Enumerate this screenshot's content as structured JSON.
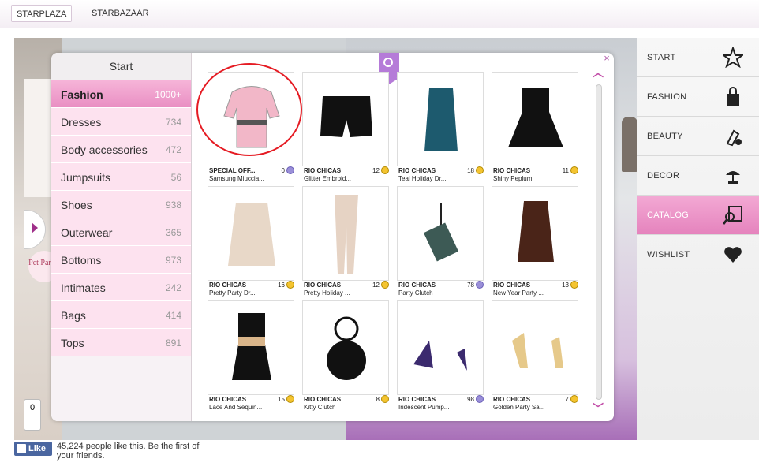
{
  "topbar": {
    "tab1": "STARPLAZA",
    "tab2": "STARBAZAAR"
  },
  "scene": {
    "pet_label": "Pet Parlor",
    "counter": "0"
  },
  "nav": [
    {
      "label": "START",
      "icon": "star-icon"
    },
    {
      "label": "FASHION",
      "icon": "shopping-bag-icon"
    },
    {
      "label": "BEAUTY",
      "icon": "lipstick-icon"
    },
    {
      "label": "DECOR",
      "icon": "lamp-icon"
    },
    {
      "label": "CATALOG",
      "icon": "catalog-search-icon"
    },
    {
      "label": "WISHLIST",
      "icon": "heart-icon"
    }
  ],
  "catalog": {
    "header": "Start",
    "categories": [
      {
        "name": "Fashion",
        "count": "1000+"
      },
      {
        "name": "Dresses",
        "count": "734"
      },
      {
        "name": "Body accessories",
        "count": "472"
      },
      {
        "name": "Jumpsuits",
        "count": "56"
      },
      {
        "name": "Shoes",
        "count": "938"
      },
      {
        "name": "Outerwear",
        "count": "365"
      },
      {
        "name": "Bottoms",
        "count": "973"
      },
      {
        "name": "Intimates",
        "count": "242"
      },
      {
        "name": "Bags",
        "count": "414"
      },
      {
        "name": "Tops",
        "count": "891"
      }
    ],
    "items": [
      {
        "brand": "SPECIAL OFF...",
        "name": "Samsung Miuccia...",
        "price": "0",
        "currency": "star"
      },
      {
        "brand": "RIO CHICAS",
        "name": "Glitter Embroid...",
        "price": "12",
        "currency": "coin"
      },
      {
        "brand": "RIO CHICAS",
        "name": "Teal Holiday Dr...",
        "price": "18",
        "currency": "coin"
      },
      {
        "brand": "RIO CHICAS",
        "name": "Shiny Peplum",
        "price": "11",
        "currency": "coin"
      },
      {
        "brand": "RIO CHICAS",
        "name": "Pretty Party Dr...",
        "price": "16",
        "currency": "coin"
      },
      {
        "brand": "RIO CHICAS",
        "name": "Pretty Holiday ...",
        "price": "12",
        "currency": "coin"
      },
      {
        "brand": "RIO CHICAS",
        "name": "Party Clutch",
        "price": "78",
        "currency": "star"
      },
      {
        "brand": "RIO CHICAS",
        "name": "New Year Party ...",
        "price": "13",
        "currency": "coin"
      },
      {
        "brand": "RIO CHICAS",
        "name": "Lace And Sequin...",
        "price": "15",
        "currency": "coin"
      },
      {
        "brand": "RIO CHICAS",
        "name": "Kitty Clutch",
        "price": "8",
        "currency": "coin"
      },
      {
        "brand": "RIO CHICAS",
        "name": "Iridescent Pump...",
        "price": "98",
        "currency": "star"
      },
      {
        "brand": "RIO CHICAS",
        "name": "Golden Party Sa...",
        "price": "7",
        "currency": "coin"
      }
    ]
  },
  "footer": {
    "like_label": "Like",
    "like_text": "45,224 people like this. Be the first of your friends."
  },
  "colors": {
    "accent": "#e98fc3",
    "brand": "#b57bd8",
    "annotation": "#e51b23"
  }
}
